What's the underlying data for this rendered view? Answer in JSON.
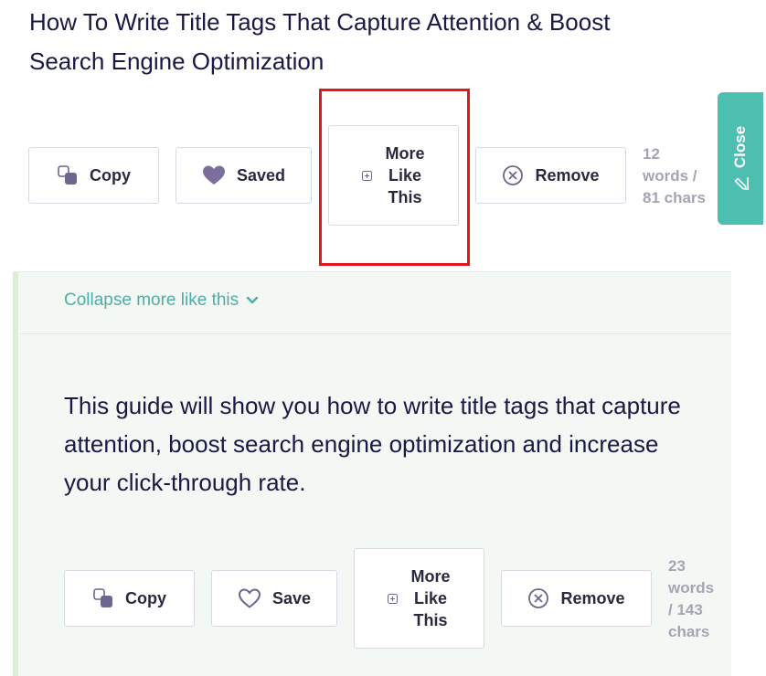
{
  "result1": {
    "title": "How To Write Title Tags That Capture Attention & Boost Search Engine Optimization",
    "copy_label": "Copy",
    "saved_label": "Saved",
    "more_lines": [
      "More",
      "Like",
      "This"
    ],
    "remove_label": "Remove",
    "stats_lines": [
      "12",
      "words /",
      "81 chars"
    ]
  },
  "close_tab": {
    "label": "Close"
  },
  "expanded": {
    "collapse_label": "Collapse more like this",
    "text": "This guide will show you how to write title tags that capture attention, boost search engine optimization and increase your click-through rate.",
    "copy_label": "Copy",
    "save_label": "Save",
    "more_lines": [
      "More",
      "Like",
      "This"
    ],
    "remove_label": "Remove",
    "stats_lines": [
      "23",
      "words",
      "/ 143",
      "chars"
    ]
  },
  "colors": {
    "teal": "#4dbfb1",
    "highlight_red": "#e3161e",
    "heart_purple": "#7a6f9a",
    "panel_bg": "#f4f8f4"
  }
}
